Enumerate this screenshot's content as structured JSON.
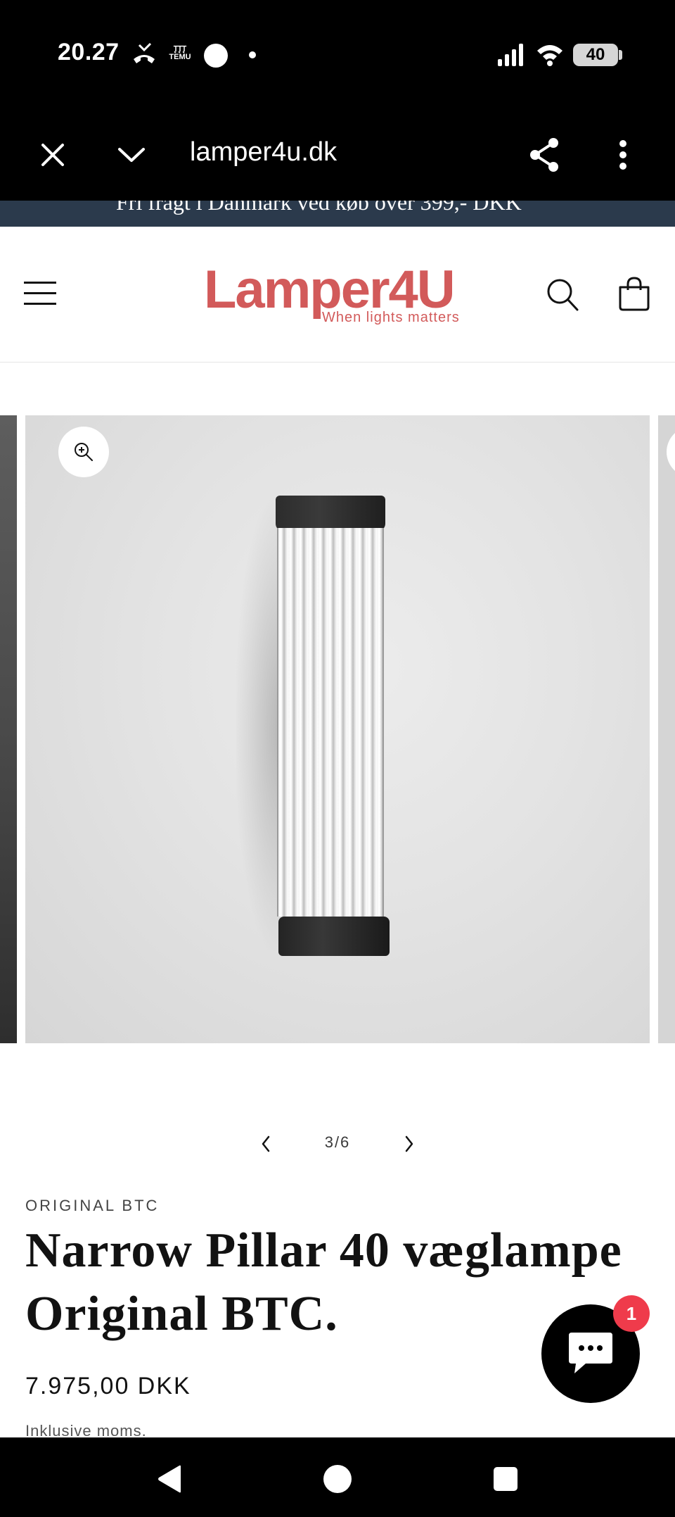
{
  "status_bar": {
    "time": "20.27",
    "battery": "40",
    "icons": [
      "missed-call-icon",
      "temu-notification-icon",
      "record-dot-icon",
      "small-dot-icon",
      "signal-icon",
      "wifi-icon",
      "battery-icon"
    ],
    "temu_line1": "ꚐꚐꚐ",
    "temu_line2": "TEMU"
  },
  "browser": {
    "url": "lamper4u.dk",
    "icons": [
      "close-icon",
      "chevron-down-icon",
      "share-icon",
      "more-vert-icon"
    ]
  },
  "announcement": {
    "text": "Fri fragt i Danmark ved køb over 399,- DKK"
  },
  "header": {
    "logo_text": "Lamper4U",
    "logo_tagline": "When lights matters",
    "icons": [
      "menu-icon",
      "search-icon",
      "cart-icon"
    ]
  },
  "gallery": {
    "counter": "3/6",
    "icons": [
      "zoom-in-icon",
      "chevron-left-icon",
      "chevron-right-icon"
    ]
  },
  "product": {
    "vendor": "ORIGINAL BTC",
    "title": "Narrow Pillar 40 væglampe Original BTC.",
    "price": "7.975,00 DKK",
    "tax_note": "Inklusive moms."
  },
  "chat": {
    "badge": "1",
    "icon": "chat-bubble-icon"
  },
  "nav": {
    "icons": [
      "back-icon",
      "home-icon",
      "recents-icon"
    ]
  },
  "colors": {
    "brand": "#d25a5a",
    "announcement_bg": "#2b3a4c",
    "badge": "#ef3b4b",
    "text": "#121212"
  }
}
